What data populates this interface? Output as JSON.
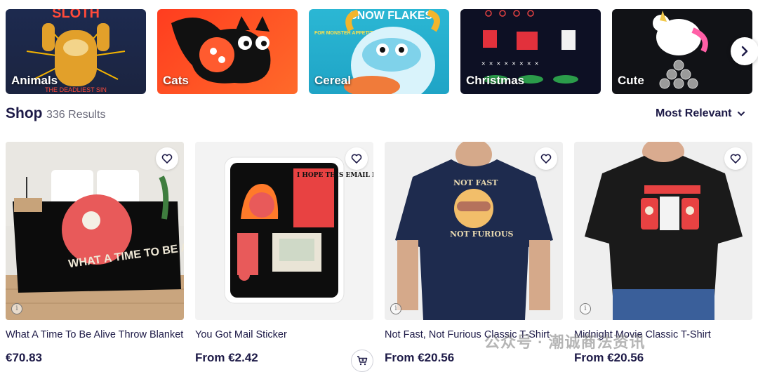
{
  "categories": [
    {
      "label": "Animals"
    },
    {
      "label": "Cats"
    },
    {
      "label": "Cereal"
    },
    {
      "label": "Christmas"
    },
    {
      "label": "Cute"
    }
  ],
  "shop": {
    "title": "Shop",
    "results": "336 Results",
    "sort_label": "Most Relevant"
  },
  "products": [
    {
      "title": "What A Time To Be Alive Throw Blanket",
      "price": "€70.83"
    },
    {
      "title": "You Got Mail Sticker",
      "price": "From €2.42"
    },
    {
      "title": "Not Fast, Not Furious Classic T-Shirt",
      "price": "From €20.56"
    },
    {
      "title": "Midnight Movie Classic T-Shirt",
      "price": "From €20.56"
    }
  ],
  "art_text": {
    "animals_top": "SLOTH",
    "animals_bottom": "THE DEADLIEST SIN",
    "cereal_top": "SNOW FLAKES",
    "cereal_side": "FOR MONSTER APPETITES!",
    "blanket": "WHAT A TIME TO BE ALIVE",
    "sticker": "I HOPE THIS EMAIL FINDS YOU WELL",
    "shirt_top": "NOT FAST",
    "shirt_bottom": "NOT FURIOUS"
  },
  "watermark": "公众号 · 潮诚商法资讯",
  "icons": {
    "next": "chevron-right-icon",
    "sort": "chevron-down-icon",
    "wishlist": "heart-icon",
    "info": "info-icon",
    "cart": "add-to-cart-icon"
  }
}
